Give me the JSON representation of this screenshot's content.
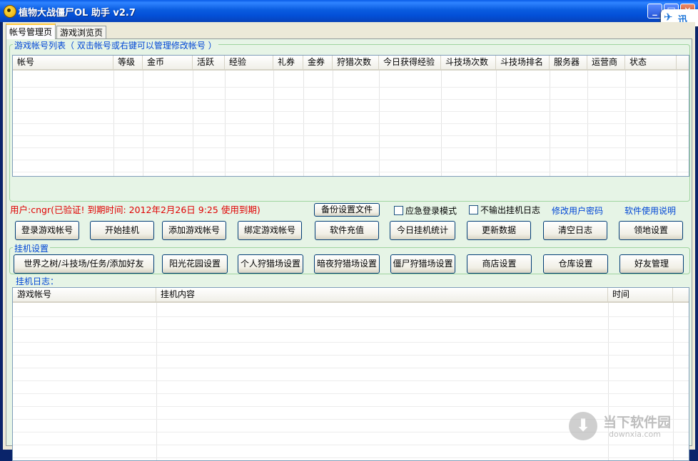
{
  "window": {
    "title": "植物大战僵尸OL 助手  v2.7",
    "minimize_label": "_",
    "maximize_label": "□",
    "close_label": "✕"
  },
  "overlay": {
    "xunlei_label": "迅"
  },
  "tabs": [
    {
      "label": "帐号管理页",
      "active": true
    },
    {
      "label": "游戏浏览页",
      "active": false
    }
  ],
  "account_list": {
    "title": "游戏帐号列表（ 双击帐号或右键可以管理修改帐号 ）",
    "columns": [
      "帐号",
      "等级",
      "金币",
      "活跃",
      "经验",
      "礼券",
      "金券",
      "狩猎次数",
      "今日获得经验",
      "斗技场次数",
      "斗技场排名",
      "服务器",
      "运营商",
      "状态"
    ]
  },
  "user_status": "用户:cngr(已验证! 到期时间: 2012年2月26日 9:25 使用到期)",
  "backup_button": "备份设置文件",
  "checkboxes": [
    {
      "label": "应急登录模式",
      "checked": false
    },
    {
      "label": "不输出挂机日志",
      "checked": false
    }
  ],
  "links": {
    "change_password": "修改用户密码",
    "help": "软件使用说明"
  },
  "action_buttons": [
    "登录游戏帐号",
    "开始挂机",
    "添加游戏帐号",
    "绑定游戏帐号",
    "软件充值",
    "今日挂机统计",
    "更新数据",
    "清空日志",
    "领地设置"
  ],
  "hangup_settings": {
    "title": "挂机设置",
    "buttons": [
      "世界之树/斗技场/任务/添加好友",
      "阳光花园设置",
      "个人狩猎场设置",
      "暗夜狩猎场设置",
      "僵尸狩猎场设置",
      "商店设置",
      "仓库设置",
      "好友管理"
    ]
  },
  "log": {
    "title": "挂机日志：",
    "columns": [
      "游戏帐号",
      "挂机内容",
      "时间"
    ]
  },
  "watermark": {
    "cn": "当下软件园",
    "en": "downxia.com",
    "icon": "download-arrow-icon"
  }
}
